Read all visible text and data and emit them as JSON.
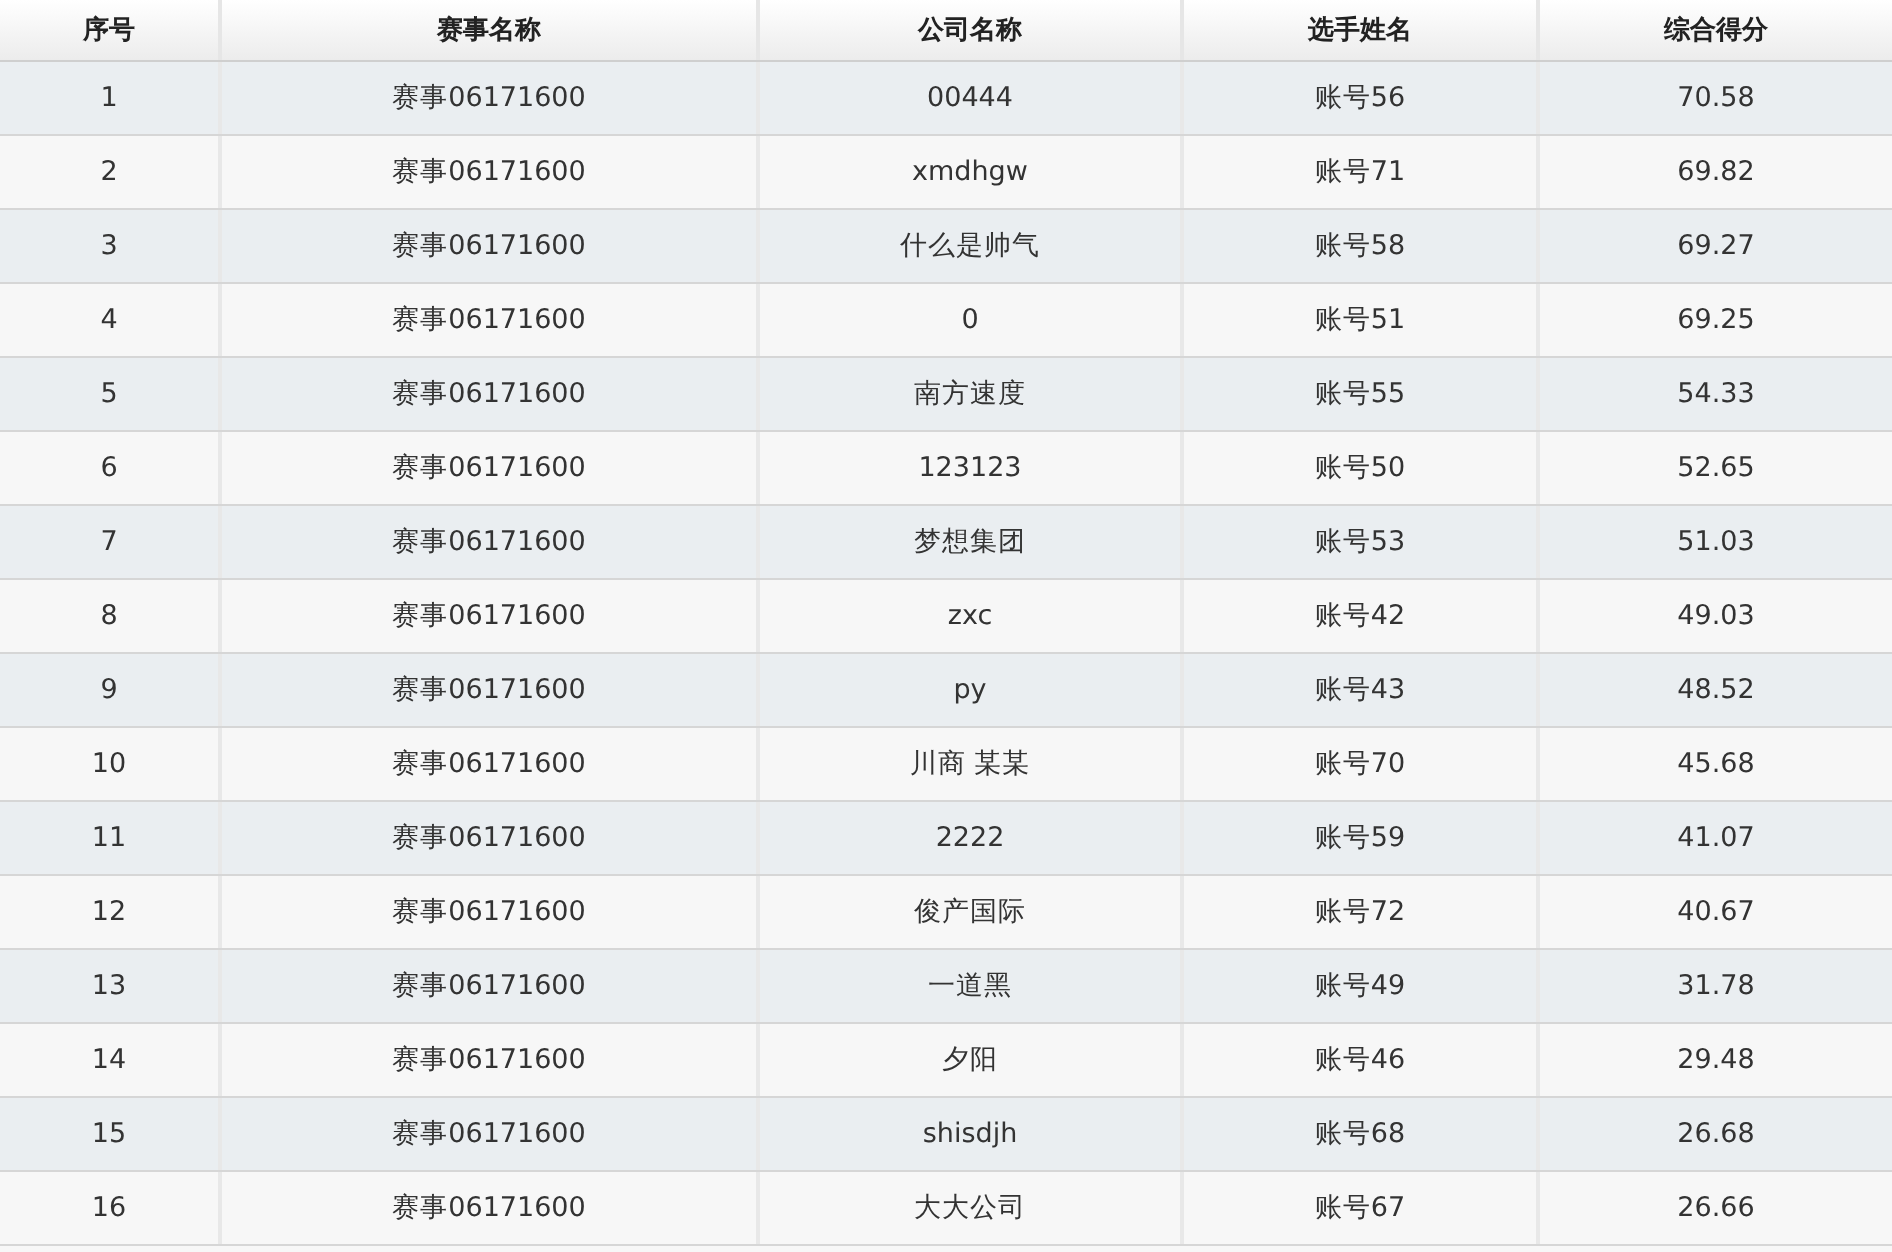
{
  "table": {
    "columns": [
      "序号",
      "赛事名称",
      "公司名称",
      "选手姓名",
      "综合得分"
    ],
    "rows": [
      [
        "1",
        "赛事06171600",
        "00444",
        "账号56",
        "70.58"
      ],
      [
        "2",
        "赛事06171600",
        "xmdhgw",
        "账号71",
        "69.82"
      ],
      [
        "3",
        "赛事06171600",
        "什么是帅气",
        "账号58",
        "69.27"
      ],
      [
        "4",
        "赛事06171600",
        "0",
        "账号51",
        "69.25"
      ],
      [
        "5",
        "赛事06171600",
        "南方速度",
        "账号55",
        "54.33"
      ],
      [
        "6",
        "赛事06171600",
        "123123",
        "账号50",
        "52.65"
      ],
      [
        "7",
        "赛事06171600",
        "梦想集团",
        "账号53",
        "51.03"
      ],
      [
        "8",
        "赛事06171600",
        "zxc",
        "账号42",
        "49.03"
      ],
      [
        "9",
        "赛事06171600",
        "py",
        "账号43",
        "48.52"
      ],
      [
        "10",
        "赛事06171600",
        "川商 某某",
        "账号70",
        "45.68"
      ],
      [
        "11",
        "赛事06171600",
        "2222",
        "账号59",
        "41.07"
      ],
      [
        "12",
        "赛事06171600",
        "俊产国际",
        "账号72",
        "40.67"
      ],
      [
        "13",
        "赛事06171600",
        "一道黑",
        "账号49",
        "31.78"
      ],
      [
        "14",
        "赛事06171600",
        "夕阳",
        "账号46",
        "29.48"
      ],
      [
        "15",
        "赛事06171600",
        "shisdjh",
        "账号68",
        "26.68"
      ],
      [
        "16",
        "赛事06171600",
        "大大公司",
        "账号67",
        "26.66"
      ]
    ]
  }
}
